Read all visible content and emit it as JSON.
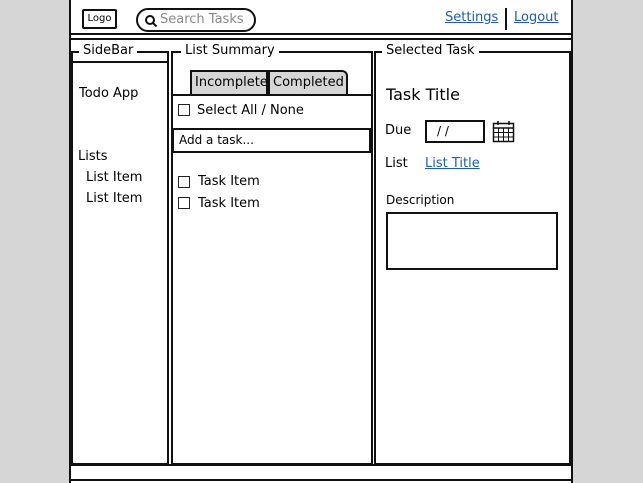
{
  "header": {
    "logo": "Logo",
    "search_placeholder": "Search Tasks",
    "settings_link": "Settings",
    "logout_link": "Logout"
  },
  "sidebar": {
    "title": "SideBar",
    "app_title": "Todo App",
    "lists_label": "Lists",
    "items": [
      "List Item",
      "List Item"
    ]
  },
  "list_summary": {
    "title": "List Summary",
    "tabs": [
      {
        "label": "Incomplete"
      },
      {
        "label": "Completed"
      }
    ],
    "select_all_label": "Select All / None",
    "add_placeholder": "Add a task...",
    "tasks": [
      {
        "label": "Task Item"
      },
      {
        "label": "Task Item"
      }
    ]
  },
  "selected_task": {
    "title": "Selected Task",
    "task_title": "Task Title",
    "due_label": "Due",
    "due_value": "/ /",
    "list_label": "List",
    "list_title_link": "List Title",
    "description_label": "Description",
    "description_value": ""
  },
  "colors": {
    "link": "#1e5fa8",
    "gutter": "#d6d6d6",
    "tab": "#d6d6d6"
  }
}
